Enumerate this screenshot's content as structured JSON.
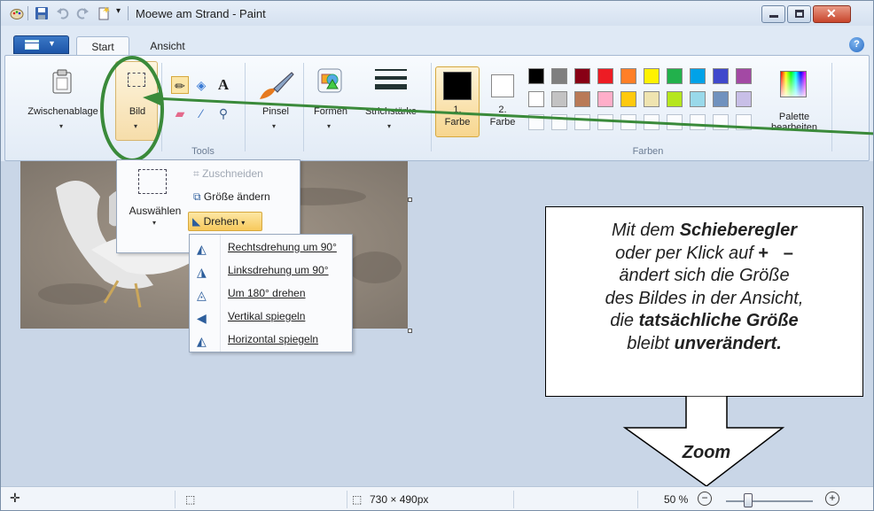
{
  "window": {
    "title": "Moewe am Strand - Paint"
  },
  "tabs": [
    {
      "label": "Start"
    },
    {
      "label": "Ansicht"
    }
  ],
  "ribbon": {
    "zwischenablage": "Zwischenablage",
    "bild": "Bild",
    "tools_group": "Tools",
    "pinsel": "Pinsel",
    "formen": "Formen",
    "strichstaerke": "Strichstärke",
    "farbe1_line1": "1.",
    "farbe1_line2": "Farbe",
    "farbe2_line1": "2.",
    "farbe2_line2": "Farbe",
    "farben_group": "Farben",
    "palette_line1": "Palette",
    "palette_line2": "bearbeiten"
  },
  "colors": {
    "row1": [
      "#000000",
      "#7f7f7f",
      "#880015",
      "#ed1c24",
      "#ff7f27",
      "#fff200",
      "#22b14c",
      "#00a2e8",
      "#3f48cc",
      "#a349a4"
    ],
    "row2": [
      "#ffffff",
      "#c3c3c3",
      "#b97a57",
      "#ffaec9",
      "#ffc90e",
      "#efe4b0",
      "#b5e61d",
      "#99d9ea",
      "#7092be",
      "#c8bfe7"
    ],
    "farbe1": "#000000",
    "farbe2": "#ffffff",
    "annotation": "#3a8a3a"
  },
  "bild_menu": {
    "auswaehlen": "Auswählen",
    "zuschneiden": "Zuschneiden",
    "groesse_aendern": "Größe ändern",
    "drehen": "Drehen"
  },
  "drehen_menu": [
    {
      "label": "Rechtsdrehung um 90°",
      "icon": "rotate-right-icon"
    },
    {
      "label": "Linksdrehung um 90°",
      "icon": "rotate-left-icon"
    },
    {
      "label": "Um 180° drehen",
      "icon": "rotate-180-icon"
    },
    {
      "label": "Vertikal spiegeln",
      "icon": "flip-vertical-icon"
    },
    {
      "label": "Horizontal spiegeln",
      "icon": "flip-horizontal-icon"
    }
  ],
  "callout": {
    "l1a": "Mit dem ",
    "l1b": "Schieberegler",
    "l2a": "oder per Klick auf ",
    "plus": "+",
    "minus": "–",
    "l3": "ändert sich die Größe",
    "l4": "des Bildes in der Ansicht,",
    "l5a": "die ",
    "l5b": "tatsächliche Größe",
    "l6a": "bleibt ",
    "l6b": "unverändert.",
    "zoom_label": "Zoom"
  },
  "status": {
    "image_size": "730 × 490px",
    "zoom": "50 %",
    "zoom_fraction": 0.5
  }
}
